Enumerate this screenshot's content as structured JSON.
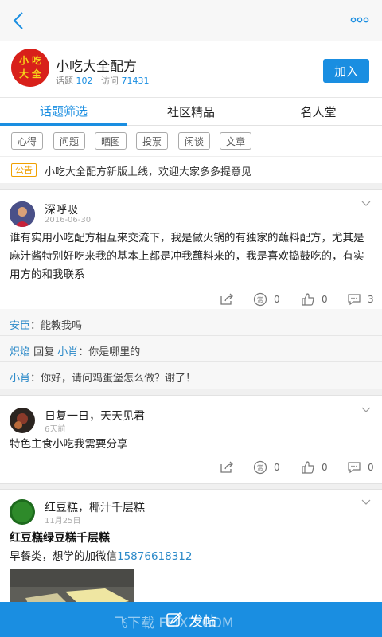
{
  "group": {
    "name": "小吃大全配方",
    "logo_text": [
      "小",
      "吃",
      "大",
      "全"
    ],
    "topics_label": "话题",
    "topics_count": "102",
    "visits_label": "访问",
    "visits_count": "71431",
    "join_label": "加入"
  },
  "tabs": [
    {
      "label": "话题筛选",
      "active": true
    },
    {
      "label": "社区精品",
      "active": false
    },
    {
      "label": "名人堂",
      "active": false
    }
  ],
  "filters": [
    "心得",
    "问题",
    "晒图",
    "投票",
    "闲谈",
    "文章"
  ],
  "notice": {
    "badge": "公告",
    "text": "小吃大全配方新版上线，欢迎大家多多提意见"
  },
  "posts": [
    {
      "author": "深呼吸",
      "date": "2016-06-30",
      "body": "谁有实用小吃配方相互来交流下，我是做火锅的有独家的蘸料配方，尤其是麻汁酱特别好吃来我的基本上都是冲我蘸料来的，我是喜欢捣鼓吃的，有实用方的和我联系",
      "reward": "0",
      "likes": "0",
      "comments": "3",
      "replies": [
        {
          "user": "安臣",
          "text": "：能教我吗"
        },
        {
          "user": "炽焰",
          "action": " 回复 ",
          "target": "小肖",
          "text": "：你是哪里的"
        },
        {
          "user": "小肖",
          "text": "：你好，请问鸡蛋堡怎么做？谢了！"
        }
      ]
    },
    {
      "author": "日复一日，天天见君",
      "date": "6天前",
      "body": "特色主食小吃我需要分享",
      "reward": "0",
      "likes": "0",
      "comments": "0"
    },
    {
      "author": "红豆糕，椰汁千层糕",
      "date": "11月25日",
      "title": "红豆糕绿豆糕千层糕",
      "body_prefix": "早餐类，想学的加微信",
      "body_phone": "15876618312"
    }
  ],
  "footer": {
    "label": "发帖",
    "watermark": "飞下载 FEIXZ.COM"
  },
  "colors": {
    "accent": "#1a8ee1",
    "logo_red": "#d8201a",
    "notice_orange": "#f0a000"
  }
}
